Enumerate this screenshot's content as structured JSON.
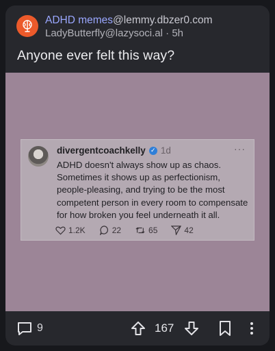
{
  "post": {
    "community_name": "ADHD memes",
    "community_instance": "@lemmy.dbzer0.com",
    "author": "LadyButterfly@lazysoci.al",
    "separator": " · ",
    "age": "5h",
    "title": "Anyone ever felt this way?"
  },
  "tweet": {
    "username": "divergentcoachkelly",
    "time": "1d",
    "more": "···",
    "body": "ADHD doesn't always show up as chaos. Sometimes it shows up as perfectionism, people-pleasing, and trying to be the most competent person in every room to compensate for how broken you feel underneath it all.",
    "likes": "1.2K",
    "replies": "22",
    "retweets": "65",
    "shares": "42"
  },
  "actions": {
    "comment_count": "9",
    "score": "167"
  },
  "colors": {
    "accent": "#9aa7ff",
    "avatar_bg": "#ec5a2b",
    "image_bg": "#9c8597"
  }
}
